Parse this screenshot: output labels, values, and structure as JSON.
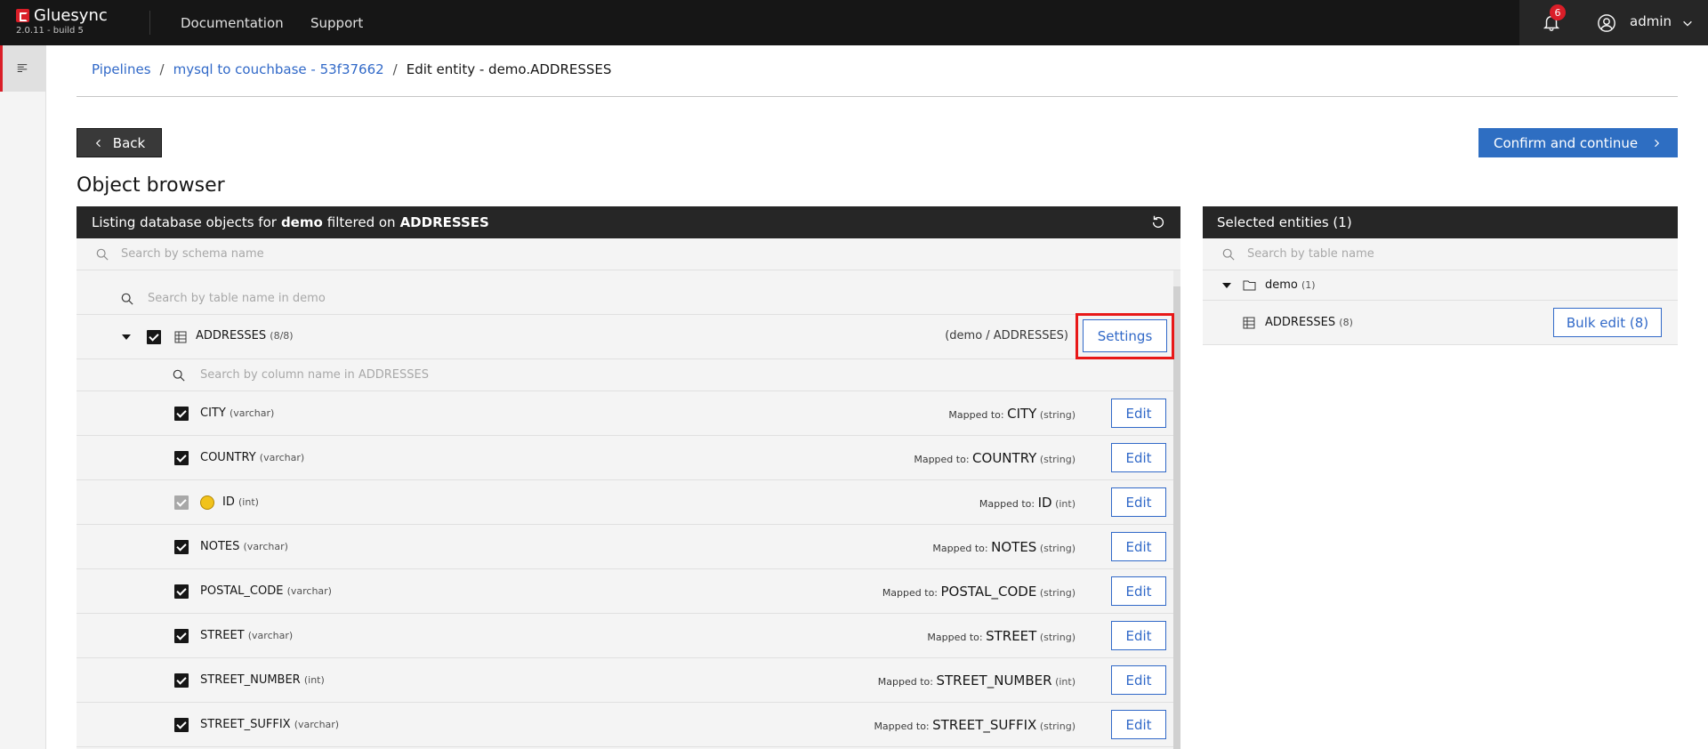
{
  "app": {
    "name": "Gluesync",
    "version": "2.0.11 - build 5",
    "nav": [
      "Documentation",
      "Support"
    ],
    "notifications_count": "6",
    "user": "admin",
    "accent_color": "#da1e28",
    "primary_color": "#2e6ec2"
  },
  "breadcrumb": {
    "items": [
      "Pipelines",
      "mysql to couchbase - 53f37662"
    ],
    "separator": "/",
    "current": "Edit entity - demo.ADDRESSES"
  },
  "actions": {
    "back_label": "Back",
    "confirm_label": "Confirm and continue"
  },
  "page_title": "Object browser",
  "object_browser": {
    "header_prefix": "Listing database objects for ",
    "schema": "demo",
    "header_mid": " filtered on ",
    "filter": "ADDRESSES",
    "schema_search_placeholder": "Search by schema name",
    "table_search_placeholder": "Search by table name in demo",
    "table": {
      "name": "ADDRESSES",
      "count": "(8/8)",
      "path": "(demo / ADDRESSES)",
      "settings_label": "Settings"
    },
    "column_search_placeholder": "Search by column name in ADDRESSES",
    "mapped_prefix": "Mapped to: ",
    "edit_label": "Edit",
    "columns": [
      {
        "name": "CITY",
        "type": "(varchar)",
        "target": "CITY",
        "target_type": "(string)",
        "checked": true,
        "key": false
      },
      {
        "name": "COUNTRY",
        "type": "(varchar)",
        "target": "COUNTRY",
        "target_type": "(string)",
        "checked": true,
        "key": false
      },
      {
        "name": "ID",
        "type": "(int)",
        "target": "ID",
        "target_type": "(int)",
        "checked": true,
        "key": true
      },
      {
        "name": "NOTES",
        "type": "(varchar)",
        "target": "NOTES",
        "target_type": "(string)",
        "checked": true,
        "key": false
      },
      {
        "name": "POSTAL_CODE",
        "type": "(varchar)",
        "target": "POSTAL_CODE",
        "target_type": "(string)",
        "checked": true,
        "key": false
      },
      {
        "name": "STREET",
        "type": "(varchar)",
        "target": "STREET",
        "target_type": "(string)",
        "checked": true,
        "key": false
      },
      {
        "name": "STREET_NUMBER",
        "type": "(int)",
        "target": "STREET_NUMBER",
        "target_type": "(int)",
        "checked": true,
        "key": false
      },
      {
        "name": "STREET_SUFFIX",
        "type": "(varchar)",
        "target": "STREET_SUFFIX",
        "target_type": "(string)",
        "checked": true,
        "key": false
      }
    ]
  },
  "selected_entities": {
    "title": "Selected entities (1)",
    "search_placeholder": "Search by table name",
    "schema_name": "demo",
    "schema_count": "(1)",
    "table_name": "ADDRESSES",
    "table_count": "(8)",
    "bulk_edit_label": "Bulk edit (8)"
  }
}
